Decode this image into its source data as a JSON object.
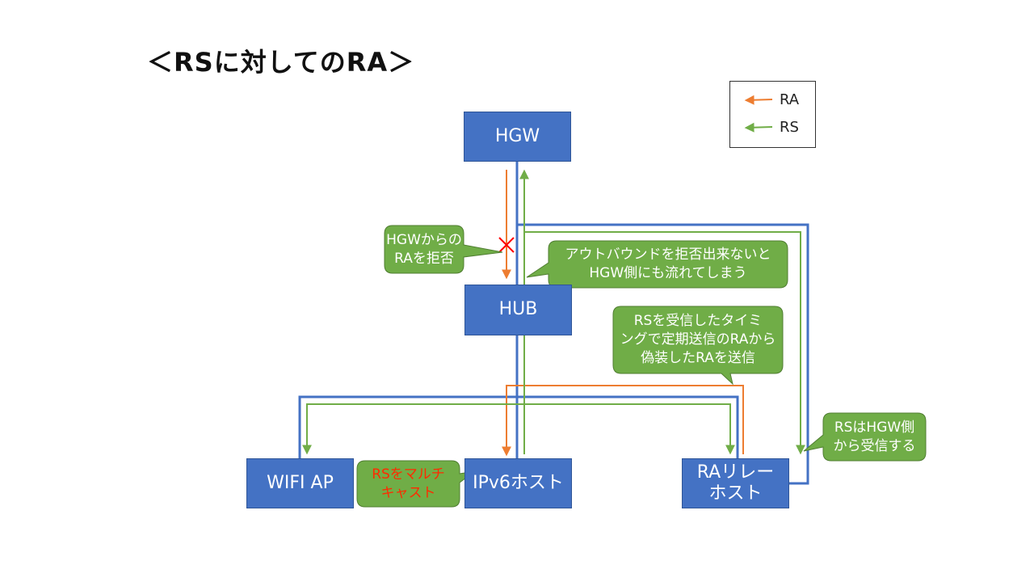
{
  "title": "＜RSに対してのRA＞",
  "colors": {
    "node_fill": "#4472c4",
    "link_blue": "#4472c4",
    "ra_orange": "#ed7d31",
    "rs_green": "#70ad47",
    "callout_green": "#70ad47",
    "block_x": "#ff0000"
  },
  "nodes": {
    "hgw": "HGW",
    "hub": "HUB",
    "wifi_ap": "WIFI AP",
    "ipv6_host": "IPv6ホスト",
    "ra_relay": [
      "RAリレー",
      "ホスト"
    ]
  },
  "callouts": {
    "hgw_reject": [
      "HGWからの",
      "RAを拒否"
    ],
    "outbound": [
      "アウトバウンドを拒否出来ないと",
      "HGW側にも流れてしまう"
    ],
    "timing": [
      "RSを受信したタイミ",
      "ングで定期送信のRAから",
      "偽装したRAを送信"
    ],
    "rs_from_hgw": [
      "RSはHGW側",
      "から受信する"
    ],
    "rs_multicast": [
      "RSをマルチ",
      "キャスト"
    ]
  },
  "legend": {
    "ra": "RA",
    "rs": "RS"
  }
}
